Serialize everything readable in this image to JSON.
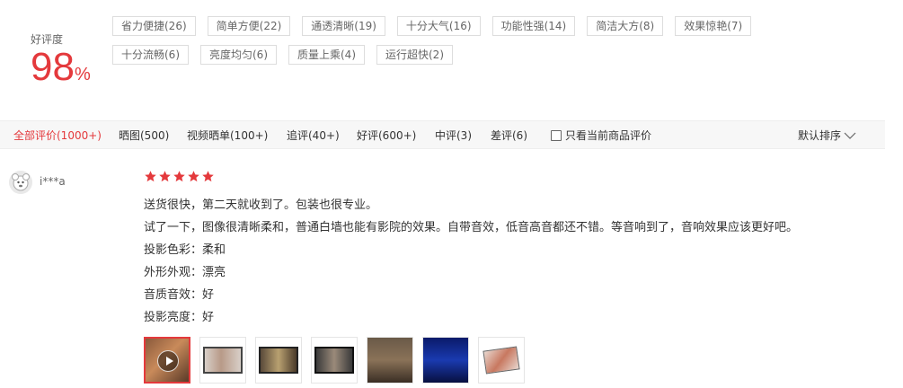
{
  "summary": {
    "label": "好评度",
    "value": "98",
    "unit": "%"
  },
  "tags": [
    "省力便捷(26)",
    "简单方便(22)",
    "通透清晰(19)",
    "十分大气(16)",
    "功能性强(14)",
    "简洁大方(8)",
    "效果惊艳(7)",
    "十分流畅(6)",
    "亮度均匀(6)",
    "质量上乘(4)",
    "运行超快(2)"
  ],
  "filters": [
    "全部评价(1000+)",
    "晒图(500)",
    "视频晒单(100+)",
    "追评(40+)",
    "好评(600+)",
    "中评(3)",
    "差评(6)"
  ],
  "only_current_label": "只看当前商品评价",
  "sort_label": "默认排序",
  "review": {
    "user": "i***a",
    "stars": 5,
    "lines": [
      "送货很快，第二天就收到了。包装也很专业。",
      "试了一下，图像很清晰柔和，普通白墙也能有影院的效果。自带音效，低音高音都还不错。等音响到了，音响效果应该更好吧。",
      "投影色彩：柔和",
      "外形外观：漂亮",
      "音质音效：好",
      "投影亮度：好"
    ]
  },
  "colors": {
    "accent": "#e4393c",
    "star": "#e4393c"
  }
}
